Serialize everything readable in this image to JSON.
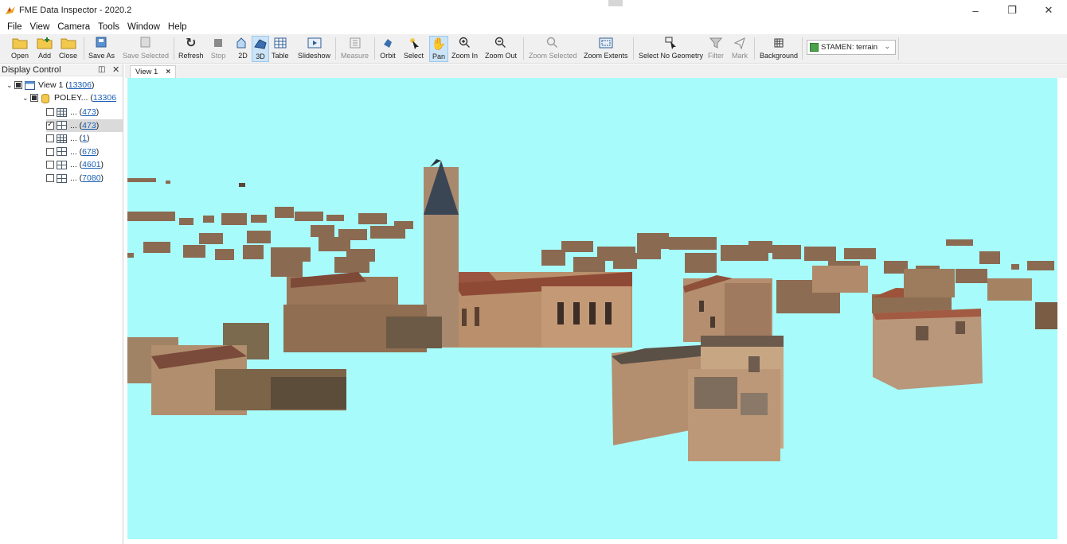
{
  "window": {
    "title": "FME Data Inspector - 2020.2"
  },
  "menu": [
    "File",
    "View",
    "Camera",
    "Tools",
    "Window",
    "Help"
  ],
  "toolbar": {
    "open": "Open",
    "add": "Add",
    "close": "Close",
    "save_as": "Save As",
    "save_selected": "Save Selected",
    "refresh": "Refresh",
    "stop": "Stop",
    "view_2d": "2D",
    "view_3d": "3D",
    "table": "Table",
    "slideshow": "Slideshow",
    "measure": "Measure",
    "orbit": "Orbit",
    "select": "Select",
    "pan": "Pan",
    "zoom_in": "Zoom In",
    "zoom_out": "Zoom Out",
    "zoom_selected": "Zoom Selected",
    "zoom_extents": "Zoom Extents",
    "select_no_geometry": "Select No Geometry",
    "filter": "Filter",
    "mark": "Mark",
    "background": "Background",
    "basemap": "STAMEN: terrain"
  },
  "display_control": {
    "title": "Display Control",
    "view": {
      "label": "View 1 (",
      "count": "13306",
      "suffix": ")"
    },
    "dataset": {
      "label": "POLEY... (",
      "count": "13306"
    },
    "layers": [
      {
        "label": "... (",
        "count": "473",
        "suffix": ")",
        "checked": false,
        "icon": "table-grid-icon"
      },
      {
        "label": "... (",
        "count": "473",
        "suffix": ")",
        "checked": true,
        "icon": "polygon-grid-icon"
      },
      {
        "label": "... (",
        "count": "1",
        "suffix": ")",
        "checked": false,
        "icon": "table-grid-icon"
      },
      {
        "label": "... (",
        "count": "678",
        "suffix": ")",
        "checked": false,
        "icon": "polygon-grid-icon"
      },
      {
        "label": "... (",
        "count": "4601",
        "suffix": ")",
        "checked": false,
        "icon": "polygon-grid-icon"
      },
      {
        "label": "... (",
        "count": "7080",
        "suffix": ")",
        "checked": false,
        "icon": "polygon-grid-icon"
      }
    ]
  },
  "tabs": [
    {
      "label": "View 1",
      "close": "×"
    }
  ],
  "colors": {
    "viewport_bg": "#a8fbfb",
    "accent": "#1a5fb4",
    "active_tool": "#cce4f7"
  }
}
